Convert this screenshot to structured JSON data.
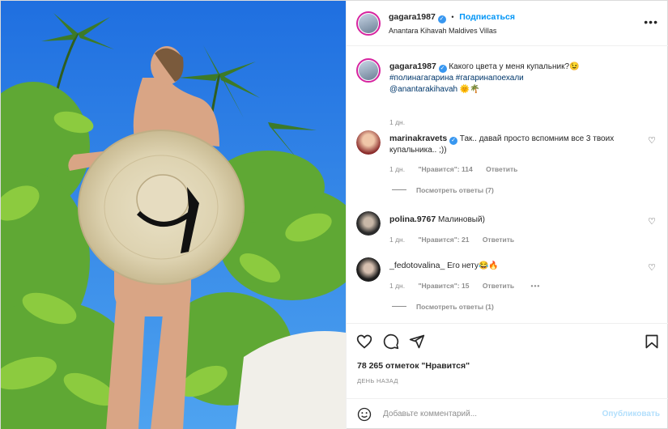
{
  "colors": {
    "accent": "#0095f6",
    "verified": "#3897f0",
    "muted": "#8e8e8e",
    "text": "#262626",
    "publish_disabled": "#b2dffc"
  },
  "post": {
    "header": {
      "username": "gagara1987",
      "separator": "•",
      "follow_label": "Подписаться",
      "location": "Anantara Kihavah Maldives Villas",
      "more_icon": "more-horizontal-icon"
    },
    "caption": {
      "username": "gagara1987",
      "text": "Какого цвета у меня купальник?😉",
      "tags_line": "#полинагагарина #гагаринапоехали",
      "mention": "@anantarakihavah",
      "mention_emoji": "🌞🌴",
      "time": "1 дн."
    },
    "comments": [
      {
        "username": "marinakravets",
        "text": "Так.. давай просто вспомним все 3 твоих купальника.. ;))",
        "time": "1 дн.",
        "likes": "\"Нравится\": 114",
        "reply": "Ответить"
      },
      {
        "username": "polina.9767",
        "text": "Малиновый)",
        "time": "1 дн.",
        "likes": "\"Нравится\": 21",
        "reply": "Ответить"
      },
      {
        "username": "_fedotovalina_",
        "text": "Его нету😂🔥",
        "time": "1 дн.",
        "likes": "\"Нравится\": 15",
        "reply": "Ответить",
        "more": "•••"
      }
    ],
    "replies_links": [
      "Посмотреть ответы (7)",
      "Посмотреть ответы (1)"
    ],
    "likes_text": "78 265 отметок \"Нравится\"",
    "when": "ДЕНЬ НАЗАД",
    "add_comment": {
      "placeholder": "Добавьте комментарий...",
      "publish": "Опубликовать"
    }
  }
}
